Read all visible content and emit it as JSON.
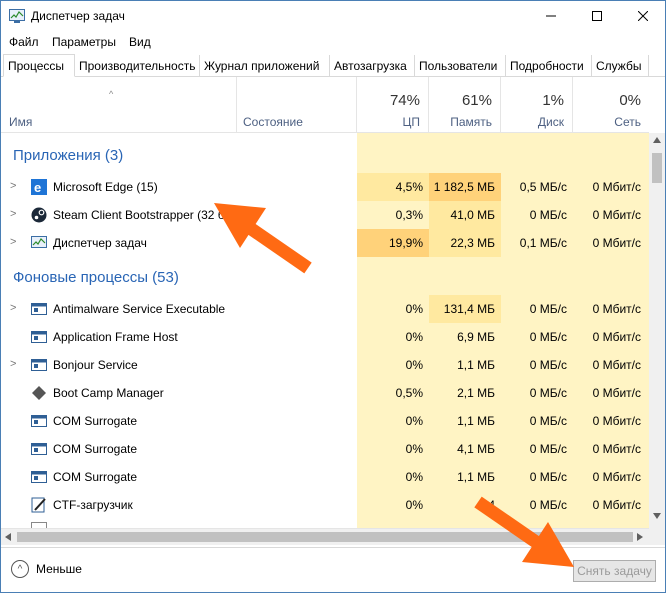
{
  "window": {
    "title": "Диспетчер задач"
  },
  "menu": [
    "Файл",
    "Параметры",
    "Вид"
  ],
  "tabs": [
    "Процессы",
    "Производительность",
    "Журнал приложений",
    "Автозагрузка",
    "Пользователи",
    "Подробности",
    "Службы"
  ],
  "columns": {
    "name": "Имя",
    "status": "Состояние",
    "cpu": {
      "pct": "74%",
      "label": "ЦП"
    },
    "mem": {
      "pct": "61%",
      "label": "Память"
    },
    "disk": {
      "pct": "1%",
      "label": "Диск"
    },
    "net": {
      "pct": "0%",
      "label": "Сеть"
    }
  },
  "groups": {
    "apps": "Приложения (3)",
    "background": "Фоновые процессы (53)"
  },
  "apps": [
    {
      "name": "Microsoft Edge (15)",
      "cpu": "4,5%",
      "mem": "1 182,5 МБ",
      "disk": "0,5 МБ/с",
      "net": "0 Мбит/с",
      "icon": "edge-icon"
    },
    {
      "name": "Steam Client Bootstrapper (32 б",
      "cpu": "0,3%",
      "mem": "41,0 МБ",
      "disk": "0 МБ/с",
      "net": "0 Мбит/с",
      "icon": "steam-icon"
    },
    {
      "name": "Диспетчер задач",
      "cpu": "19,9%",
      "mem": "22,3 МБ",
      "disk": "0,1 МБ/с",
      "net": "0 Мбит/с",
      "icon": "taskmgr-icon"
    }
  ],
  "background": [
    {
      "name": "Antimalware Service Executable",
      "cpu": "0%",
      "mem": "131,4 МБ",
      "disk": "0 МБ/с",
      "net": "0 Мбит/с",
      "expand": true
    },
    {
      "name": "Application Frame Host",
      "cpu": "0%",
      "mem": "6,9 МБ",
      "disk": "0 МБ/с",
      "net": "0 Мбит/с",
      "expand": false
    },
    {
      "name": "Bonjour Service",
      "cpu": "0%",
      "mem": "1,1 МБ",
      "disk": "0 МБ/с",
      "net": "0 Мбит/с",
      "expand": true
    },
    {
      "name": "Boot Camp Manager",
      "cpu": "0,5%",
      "mem": "2,1 МБ",
      "disk": "0 МБ/с",
      "net": "0 Мбит/с",
      "expand": false
    },
    {
      "name": "COM Surrogate",
      "cpu": "0%",
      "mem": "1,1 МБ",
      "disk": "0 МБ/с",
      "net": "0 Мбит/с",
      "expand": false
    },
    {
      "name": "COM Surrogate",
      "cpu": "0%",
      "mem": "4,1 МБ",
      "disk": "0 МБ/с",
      "net": "0 Мбит/с",
      "expand": false
    },
    {
      "name": "COM Surrogate",
      "cpu": "0%",
      "mem": "1,1 МБ",
      "disk": "0 МБ/с",
      "net": "0 Мбит/с",
      "expand": false
    },
    {
      "name": "CTF-загрузчик",
      "cpu": "0%",
      "mem": "4,4",
      "disk": "0 МБ/с",
      "net": "0 Мбит/с",
      "expand": false
    }
  ],
  "footer": {
    "less": "Меньше",
    "end_task": "Снять задачу"
  },
  "colors": {
    "accent": "#2965b5",
    "heat_light": "#fff4c4",
    "heat_mid": "#ffe9a0",
    "heat_strong": "#ffd27a",
    "annotation_arrow": "#ff6a13"
  }
}
